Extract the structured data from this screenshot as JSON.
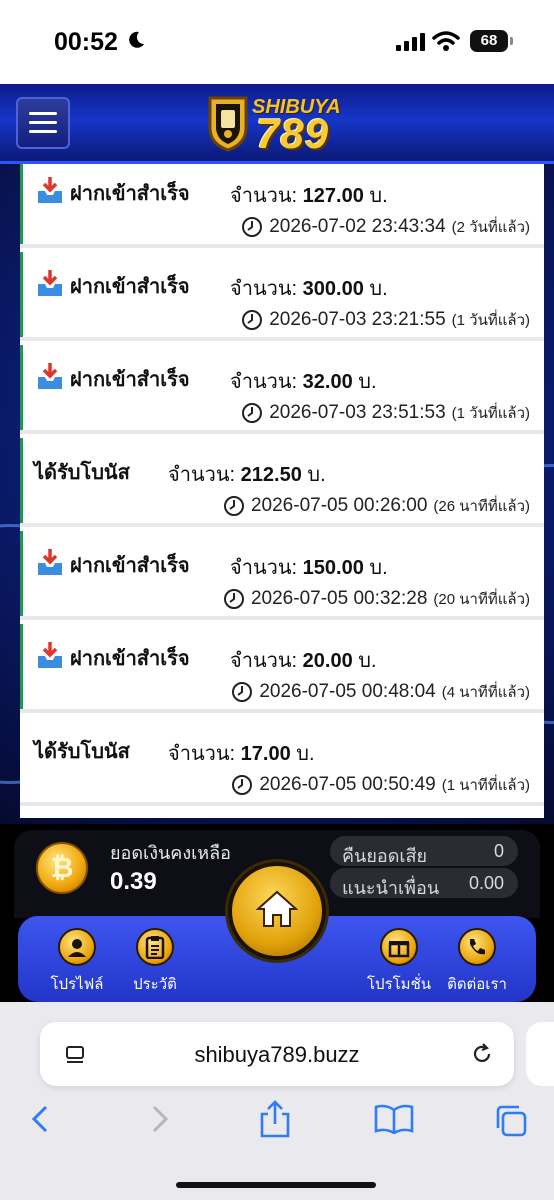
{
  "status": {
    "time": "00:52",
    "battery": "68"
  },
  "header": {
    "logo_word": "SHIBUYA",
    "logo_number": "789"
  },
  "transactions": [
    {
      "type": "ฝากเข้าสำเร็จ",
      "amount_prefix": "จำนวน:",
      "amount": "127.00",
      "currency": "บ.",
      "datetime": "2026-07-02 23:43:34",
      "ago": "(2 วันที่แล้ว)",
      "icon": "deposit-tray-icon"
    },
    {
      "type": "ฝากเข้าสำเร็จ",
      "amount_prefix": "จำนวน:",
      "amount": "300.00",
      "currency": "บ.",
      "datetime": "2026-07-03 23:21:55",
      "ago": "(1 วันที่แล้ว)",
      "icon": "deposit-tray-icon"
    },
    {
      "type": "ฝากเข้าสำเร็จ",
      "amount_prefix": "จำนวน:",
      "amount": "32.00",
      "currency": "บ.",
      "datetime": "2026-07-03 23:51:53",
      "ago": "(1 วันที่แล้ว)",
      "icon": "deposit-tray-icon"
    },
    {
      "type": "ได้รับโบนัส",
      "amount_prefix": "จำนวน:",
      "amount": "212.50",
      "currency": "บ.",
      "datetime": "2026-07-05 00:26:00",
      "ago": "(26 นาทีที่แล้ว)",
      "icon": ""
    },
    {
      "type": "ฝากเข้าสำเร็จ",
      "amount_prefix": "จำนวน:",
      "amount": "150.00",
      "currency": "บ.",
      "datetime": "2026-07-05 00:32:28",
      "ago": "(20 นาทีที่แล้ว)",
      "icon": "deposit-tray-icon"
    },
    {
      "type": "ฝากเข้าสำเร็จ",
      "amount_prefix": "จำนวน:",
      "amount": "20.00",
      "currency": "บ.",
      "datetime": "2026-07-05 00:48:04",
      "ago": "(4 นาทีที่แล้ว)",
      "icon": "deposit-tray-icon"
    },
    {
      "type": "ได้รับโบนัส",
      "amount_prefix": "จำนวน:",
      "amount": "17.00",
      "currency": "บ.",
      "datetime": "2026-07-05 00:50:49",
      "ago": "(1 นาทีที่แล้ว)",
      "icon": ""
    }
  ],
  "balance": {
    "label": "ยอดเงินคงเหลือ",
    "value": "0.39",
    "cashback_label": "คืนยอดเสีย",
    "cashback_value": "0",
    "referral_label": "แนะนำเพื่อน",
    "referral_value": "0.00"
  },
  "nav": {
    "profile": "โปรไฟล์",
    "history": "ประวัติ",
    "promotion": "โปรโมชั่น",
    "contact": "ติดต่อเรา"
  },
  "browser": {
    "url": "shibuya789.buzz"
  }
}
